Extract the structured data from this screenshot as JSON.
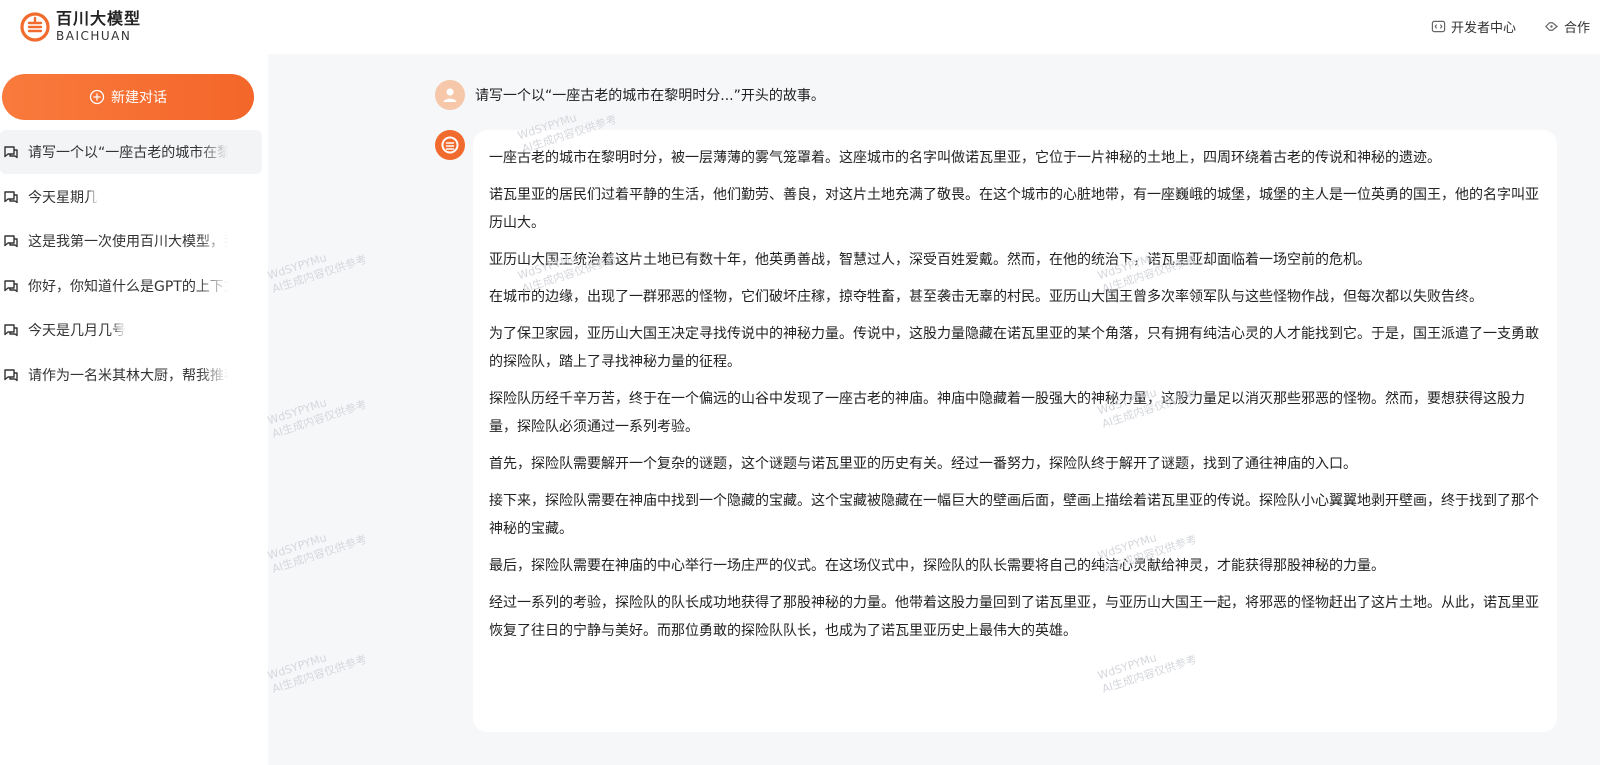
{
  "header": {
    "brand_cn": "百川大模型",
    "brand_en": "BAICHUAN",
    "actions": [
      {
        "label": "开发者中心",
        "icon": "code-icon"
      },
      {
        "label": "合作",
        "icon": "handshake-icon"
      }
    ]
  },
  "sidebar": {
    "new_chat_label": "新建对话",
    "history": [
      {
        "label": "请写一个以“一座古老的城市在黎明时分...”开头的故事。",
        "active": true
      },
      {
        "label": "今天星期几",
        "active": false
      },
      {
        "label": "这是我第一次使用百川大模型，我想了解一下你",
        "active": false
      },
      {
        "label": "你好，你知道什么是GPT的上下文窗口吗",
        "active": false
      },
      {
        "label": "今天是几月几号",
        "active": false
      },
      {
        "label": "请作为一名米其林大厨，帮我推荐几道菜",
        "active": false
      }
    ]
  },
  "conversation": {
    "user_message": "请写一个以“一座古老的城市在黎明时分...”开头的故事。",
    "answer_paragraphs": [
      "一座古老的城市在黎明时分，被一层薄薄的雾气笼罩着。这座城市的名字叫做诺瓦里亚，它位于一片神秘的土地上，四周环绕着古老的传说和神秘的遗迹。",
      "诺瓦里亚的居民们过着平静的生活，他们勤劳、善良，对这片土地充满了敬畏。在这个城市的心脏地带，有一座巍峨的城堡，城堡的主人是一位英勇的国王，他的名字叫亚历山大。",
      "亚历山大国王统治着这片土地已有数十年，他英勇善战，智慧过人，深受百姓爱戴。然而，在他的统治下，诺瓦里亚却面临着一场空前的危机。",
      "在城市的边缘，出现了一群邪恶的怪物，它们破坏庄稼，掠夺牲畜，甚至袭击无辜的村民。亚历山大国王曾多次率领军队与这些怪物作战，但每次都以失败告终。",
      "为了保卫家园，亚历山大国王决定寻找传说中的神秘力量。传说中，这股力量隐藏在诺瓦里亚的某个角落，只有拥有纯洁心灵的人才能找到它。于是，国王派遣了一支勇敢的探险队，踏上了寻找神秘力量的征程。",
      "探险队历经千辛万苦，终于在一个偏远的山谷中发现了一座古老的神庙。神庙中隐藏着一股强大的神秘力量，这股力量足以消灭那些邪恶的怪物。然而，要想获得这股力量，探险队必须通过一系列考验。",
      "首先，探险队需要解开一个复杂的谜题，这个谜题与诺瓦里亚的历史有关。经过一番努力，探险队终于解开了谜题，找到了通往神庙的入口。",
      "接下来，探险队需要在神庙中找到一个隐藏的宝藏。这个宝藏被隐藏在一幅巨大的壁画后面，壁画上描绘着诺瓦里亚的传说。探险队小心翼翼地剥开壁画，终于找到了那个神秘的宝藏。",
      "最后，探险队需要在神庙的中心举行一场庄严的仪式。在这场仪式中，探险队的队长需要将自己的纯洁心灵献给神灵，才能获得那股神秘的力量。",
      "经过一系列的考验，探险队的队长成功地获得了那股神秘的力量。他带着这股力量回到了诺瓦里亚，与亚历山大国王一起，将邪恶的怪物赶出了这片土地。从此，诺瓦里亚恢复了往日的宁静与美好。而那位勇敢的探险队队长，也成为了诺瓦里亚历史上最伟大的英雄。"
    ]
  },
  "watermark": {
    "line1": "WdSYPYMu",
    "line2": "AI生成内容仅供参考"
  },
  "colors": {
    "accent": "#f4662a",
    "sidebar_active": "#f3f4f6",
    "page_bg": "#f6f7f9"
  }
}
